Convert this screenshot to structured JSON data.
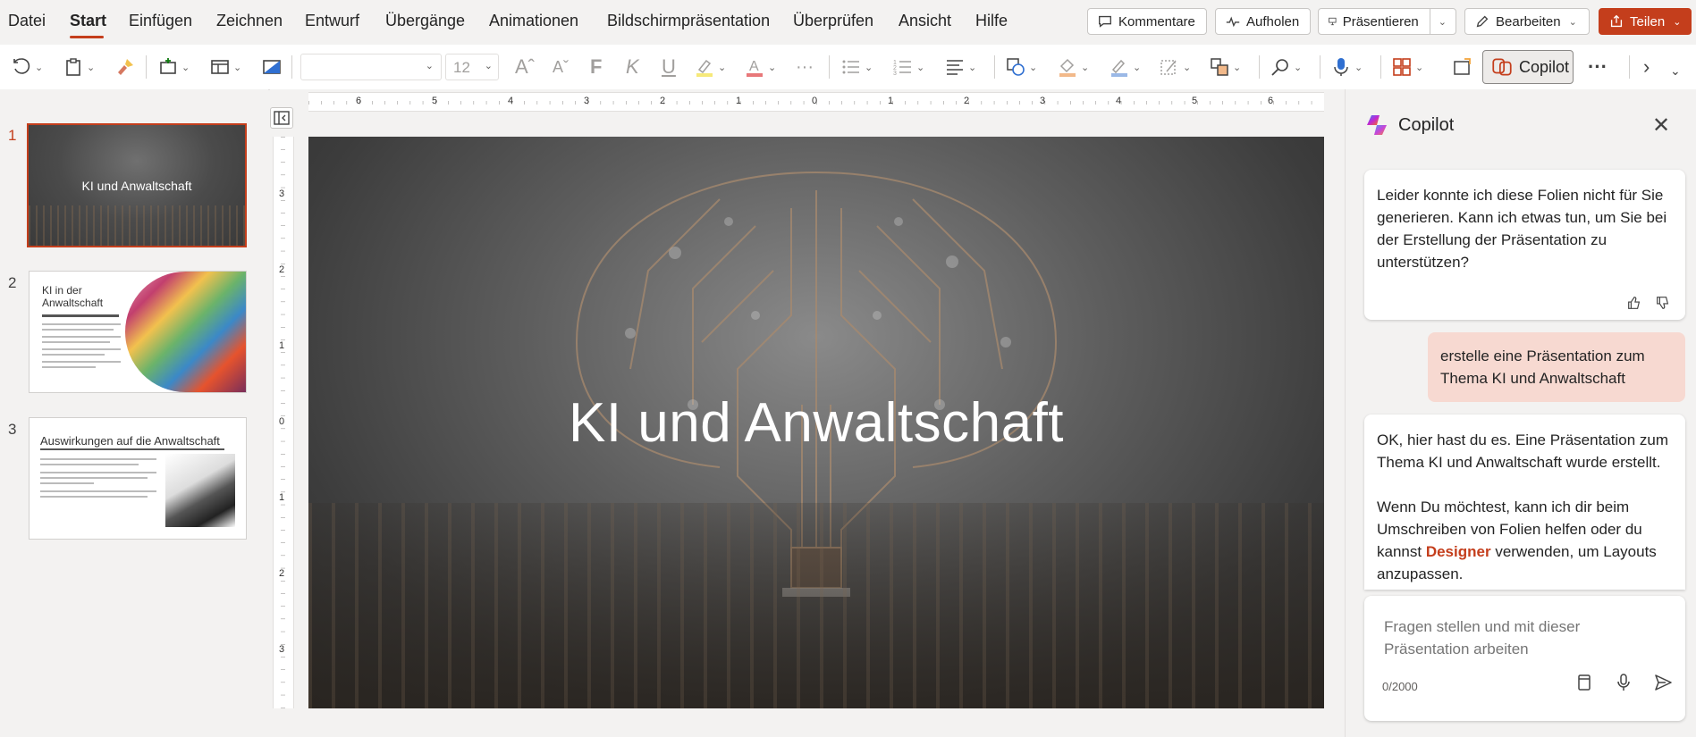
{
  "menu": {
    "items": [
      "Datei",
      "Start",
      "Einfügen",
      "Zeichnen",
      "Entwurf",
      "Übergänge",
      "Animationen",
      "Bildschirmpräsentation",
      "Überprüfen",
      "Ansicht",
      "Hilfe"
    ],
    "active": "Start"
  },
  "top_buttons": {
    "comments": "Kommentare",
    "catchup": "Aufholen",
    "present": "Präsentieren",
    "edit": "Bearbeiten",
    "share": "Teilen"
  },
  "ribbon": {
    "font_name": "",
    "font_size": "12",
    "copilot_label": "Copilot"
  },
  "thumbnails": [
    {
      "number": "1",
      "title": "KI und Anwaltschaft"
    },
    {
      "number": "2",
      "title": "KI in der Anwaltschaft"
    },
    {
      "number": "3",
      "title": "Auswirkungen auf die Anwaltschaft"
    }
  ],
  "ruler": {
    "horizontal": [
      "6",
      "5",
      "4",
      "3",
      "2",
      "1",
      "0",
      "1",
      "2",
      "3",
      "4",
      "5",
      "6"
    ],
    "vertical": [
      "3",
      "2",
      "1",
      "0",
      "1",
      "2",
      "3"
    ]
  },
  "slide": {
    "title": "KI und Anwaltschaft"
  },
  "copilot": {
    "title": "Copilot",
    "messages": {
      "bot1": "Leider konnte ich diese Folien nicht für Sie generieren. Kann ich etwas tun, um Sie bei der Erstellung der Präsentation zu unterstützen?",
      "user1": "erstelle eine Präsentation zum Thema KI und Anwaltschaft",
      "bot2_p1": "OK, hier hast du es. Eine Präsentation zum Thema KI und Anwaltschaft wurde erstellt.",
      "bot2_p2_before": "Wenn Du möchtest, kann ich dir beim Umschreiben von Folien helfen oder du kannst",
      "bot2_link": "Designer",
      "bot2_p2_after": "verwenden, um Layouts anzupassen."
    },
    "input_placeholder": "Fragen stellen und mit dieser Präsentation arbeiten",
    "char_count": "0/2000"
  },
  "colors": {
    "accent": "#c43e1c",
    "user_bubble": "#f7d9d1"
  }
}
